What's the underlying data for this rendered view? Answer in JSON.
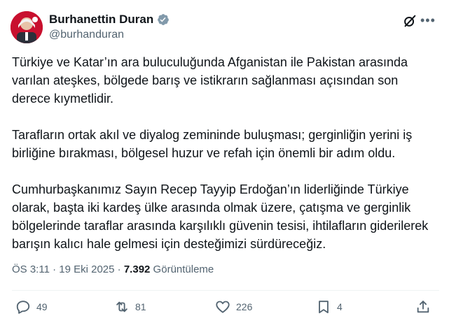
{
  "author": {
    "name": "Burhanettin Duran",
    "handle": "@burhanduran",
    "verified": true
  },
  "post": {
    "paragraphs": [
      "Türkiye ve Katar’ın ara buluculuğunda Afganistan ile Pakistan arasında varılan ateşkes, bölgede barış ve istikrarın sağlanması açısından son derece kıymetlidir.",
      "Tarafların ortak akıl ve diyalog zemininde buluşması; gerginliğin yerini iş birliğine bırakması, bölgesel huzur ve refah için önemli bir adım oldu.",
      "Cumhurbaşkanımız Sayın Recep Tayyip Erdoğan’ın liderliğinde Türkiye olarak, başta iki kardeş ülke arasında olmak üzere, çatışma ve gerginlik bölgelerinde taraflar arasında karşılıklı güvenin tesisi, ihtilafların giderilerek barışın kalıcı hale gelmesi için desteğimizi sürdüreceğiz."
    ],
    "time": "ÖS 3:11",
    "separator": " · ",
    "date": "19 Eki 2025",
    "separator2": " · ",
    "views_count": "7.392",
    "views_label": " Görüntüleme"
  },
  "actions": {
    "replies": "49",
    "reposts": "81",
    "likes": "226",
    "bookmarks": "4"
  },
  "icons": {
    "verified": "verified-badge-icon",
    "grok": "grok-icon",
    "more": "more-dots-icon",
    "reply": "reply-icon",
    "repost": "repost-icon",
    "like": "heart-icon",
    "bookmark": "bookmark-icon",
    "share": "share-icon"
  },
  "colors": {
    "text": "#0f1419",
    "secondary": "#536471",
    "verified_badge": "#829aab",
    "divider": "#eff3f4"
  }
}
